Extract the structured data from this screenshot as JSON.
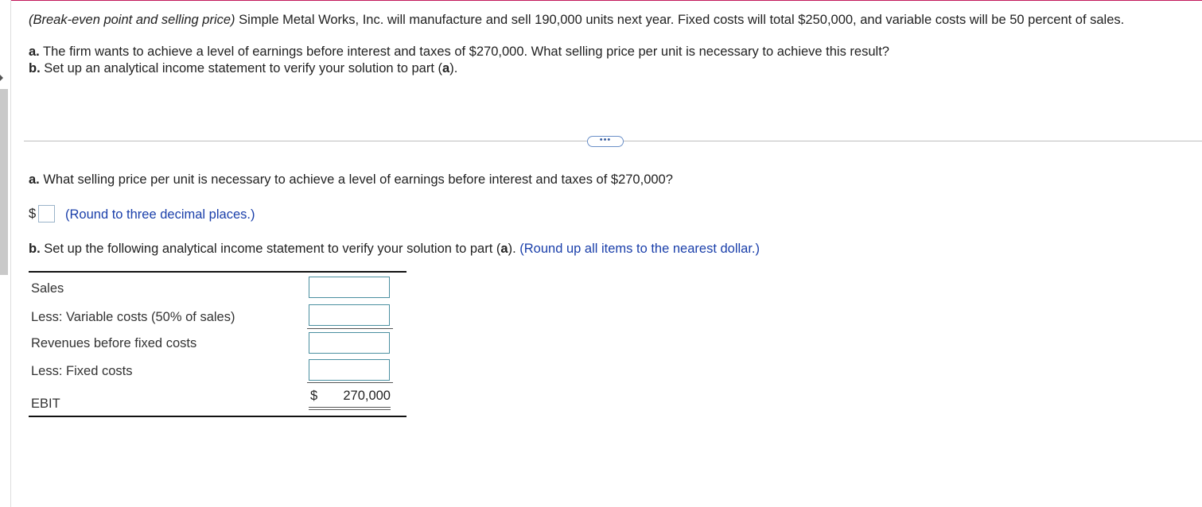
{
  "problem": {
    "topic": "(Break-even point and selling price)",
    "text": " Simple Metal Works, Inc. will manufacture and sell 190,000 units next year. Fixed costs will total $250,000, and variable costs will be 50 percent of sales.",
    "part_a_label": "a.",
    "part_a_text": " The firm wants to achieve a level of earnings before interest and taxes of $270,000. What selling price per unit is necessary to achieve this result?",
    "part_b_label": "b.",
    "part_b_text": " Set up an analytical income statement to verify your solution to part (",
    "part_b_ref": "a",
    "part_b_end": ")."
  },
  "expand_button": "•••",
  "question_a": {
    "label": "a.",
    "text": " What selling price per unit is necessary to achieve a level of earnings before interest and taxes of $270,000?",
    "currency": "$",
    "value": "",
    "hint": "(Round to three decimal places.)"
  },
  "question_b": {
    "label": "b.",
    "text": " Set up the following analytical income statement to verify your solution to part (",
    "ref": "a",
    "text_end": ").",
    "hint": "(Round up all items to the nearest dollar.)"
  },
  "income_statement": {
    "rows": [
      {
        "label": "Sales",
        "value": ""
      },
      {
        "label": "Less: Variable costs (50% of sales)",
        "value": ""
      },
      {
        "label": "Revenues before fixed costs",
        "value": ""
      },
      {
        "label": "Less: Fixed costs",
        "value": ""
      }
    ],
    "ebit_label": "EBIT",
    "ebit_currency": "$",
    "ebit_value": "270,000"
  }
}
